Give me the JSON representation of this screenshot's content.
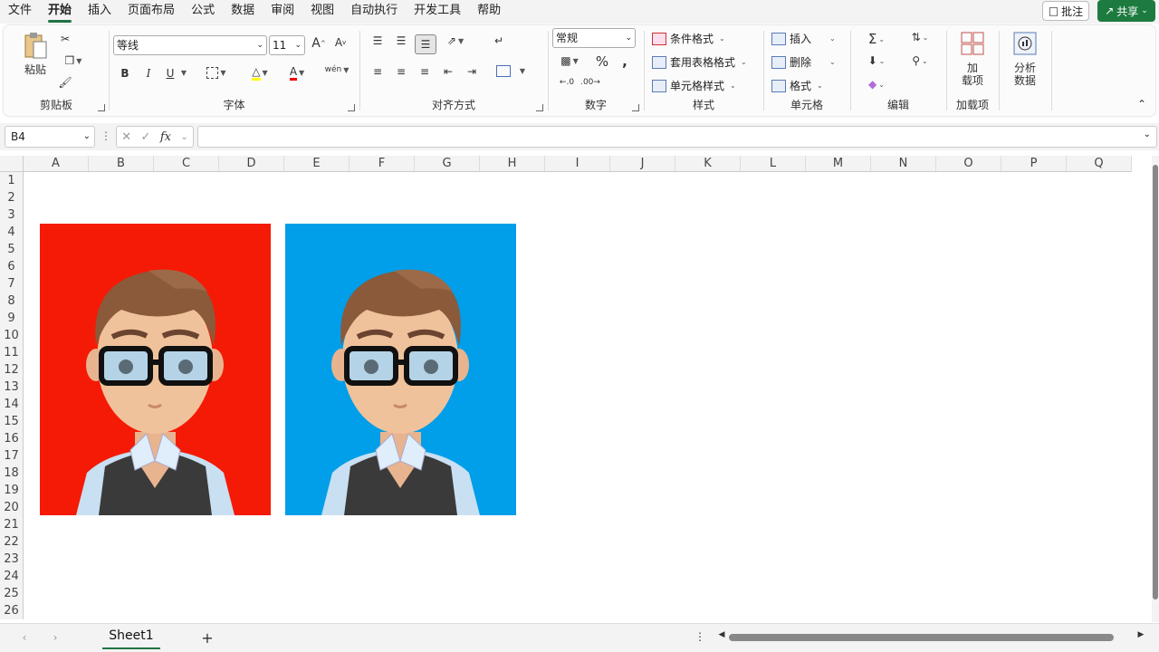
{
  "menu": {
    "tabs": [
      "文件",
      "开始",
      "插入",
      "页面布局",
      "公式",
      "数据",
      "审阅",
      "视图",
      "自动执行",
      "开发工具",
      "帮助"
    ],
    "active_index": 1,
    "comment": "批注",
    "share": "共享"
  },
  "ribbon": {
    "clipboard": {
      "paste": "粘贴",
      "label": "剪贴板"
    },
    "font": {
      "name": "等线",
      "size": "11",
      "bold": "B",
      "italic": "I",
      "underline": "U",
      "label": "字体"
    },
    "alignment": {
      "label": "对齐方式"
    },
    "number": {
      "format": "常规",
      "label": "数字"
    },
    "styles": {
      "conditional": "条件格式",
      "table": "套用表格格式",
      "cell": "单元格样式",
      "label": "样式"
    },
    "cells": {
      "insert": "插入",
      "delete": "删除",
      "format": "格式",
      "label": "单元格"
    },
    "editing": {
      "label": "编辑"
    },
    "addins": {
      "button": "加\n载项",
      "label": "加载项"
    },
    "analyze": {
      "button": "分析\n数据"
    }
  },
  "formula_bar": {
    "name_box": "B4",
    "fx": "fx",
    "value": ""
  },
  "columns": [
    "A",
    "B",
    "C",
    "D",
    "E",
    "F",
    "G",
    "H",
    "I",
    "J",
    "K",
    "L",
    "M",
    "N",
    "O",
    "P",
    "Q"
  ],
  "rows": [
    "1",
    "2",
    "3",
    "4",
    "5",
    "6",
    "7",
    "8",
    "9",
    "10",
    "11",
    "12",
    "13",
    "14",
    "15",
    "16",
    "17",
    "18",
    "19",
    "20",
    "21",
    "22",
    "23",
    "24",
    "25",
    "26"
  ],
  "photos": [
    {
      "background": "#f51a06",
      "name": "red-background-photo"
    },
    {
      "background": "#019ee9",
      "name": "blue-background-photo"
    }
  ],
  "sheets": {
    "tabs": [
      "Sheet1"
    ],
    "add": "+"
  }
}
